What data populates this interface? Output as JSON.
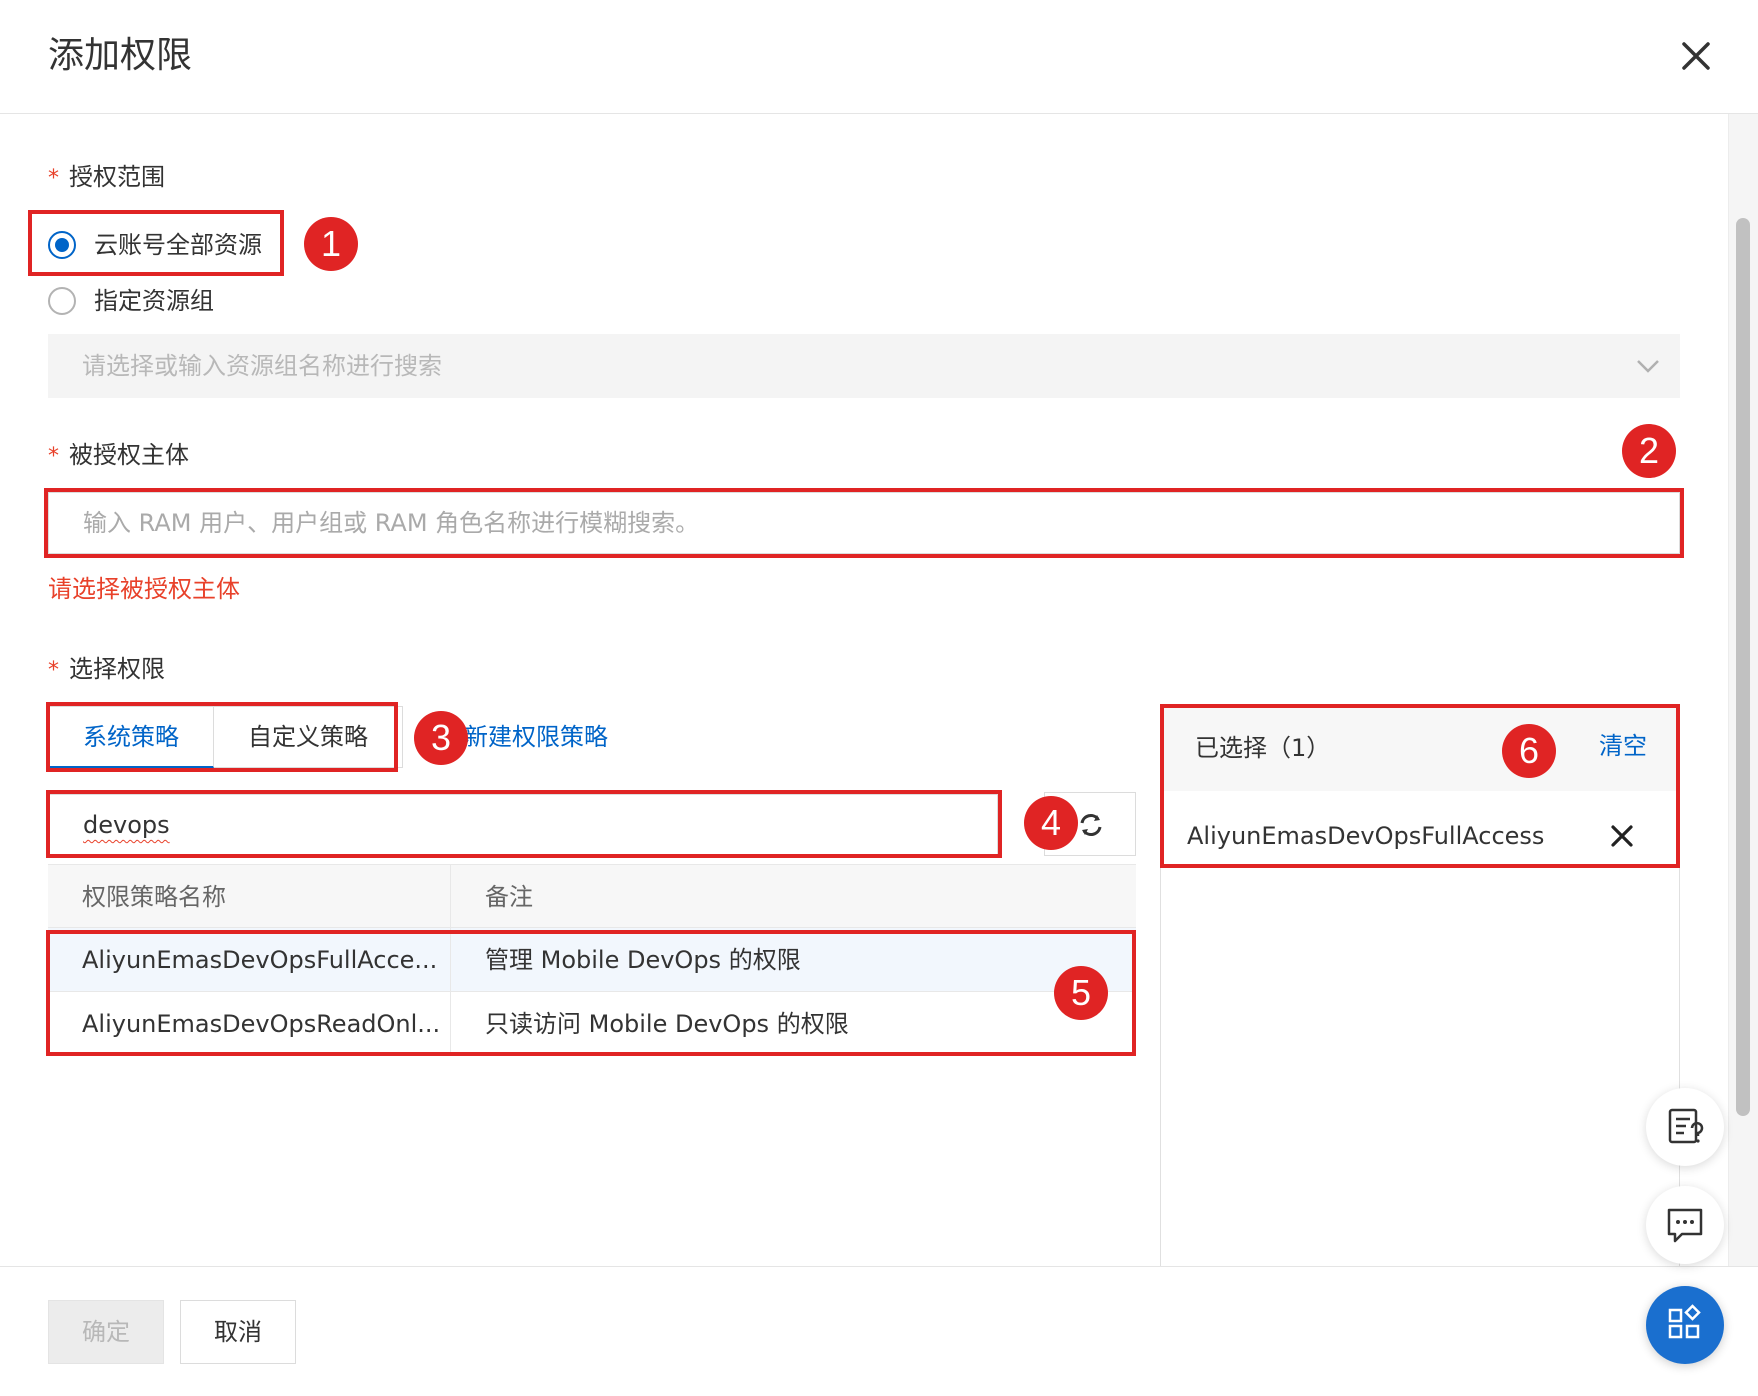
{
  "dialog": {
    "title": "添加权限"
  },
  "scope": {
    "label": "授权范围",
    "required_mark": "*",
    "options": [
      {
        "label": "云账号全部资源",
        "checked": true
      },
      {
        "label": "指定资源组",
        "checked": false
      }
    ],
    "resource_group_placeholder": "请选择或输入资源组名称进行搜索"
  },
  "principal": {
    "label": "被授权主体",
    "required_mark": "*",
    "placeholder": "输入 RAM 用户、用户组或 RAM 角色名称进行模糊搜索。",
    "error": "请选择被授权主体"
  },
  "permissions": {
    "label": "选择权限",
    "required_mark": "*",
    "tabs": [
      {
        "label": "系统策略",
        "active": true
      },
      {
        "label": "自定义策略",
        "active": false
      }
    ],
    "new_policy_link": "新建权限策略",
    "search_value": "devops",
    "table": {
      "headers": [
        "权限策略名称",
        "备注"
      ],
      "rows": [
        {
          "name": "AliyunEmasDevOpsFullAcce...",
          "note": "管理 Mobile DevOps 的权限"
        },
        {
          "name": "AliyunEmasDevOpsReadOnl...",
          "note": "只读访问 Mobile DevOps 的权限"
        }
      ]
    }
  },
  "selected": {
    "title": "已选择（1）",
    "clear_label": "清空",
    "items": [
      "AliyunEmasDevOpsFullAccess"
    ]
  },
  "footer": {
    "ok_label": "确定",
    "cancel_label": "取消"
  },
  "annotations": [
    "1",
    "2",
    "3",
    "4",
    "5",
    "6"
  ],
  "colors": {
    "accent": "#0064c8",
    "error": "#e8412a",
    "annotation": "#e02424"
  }
}
